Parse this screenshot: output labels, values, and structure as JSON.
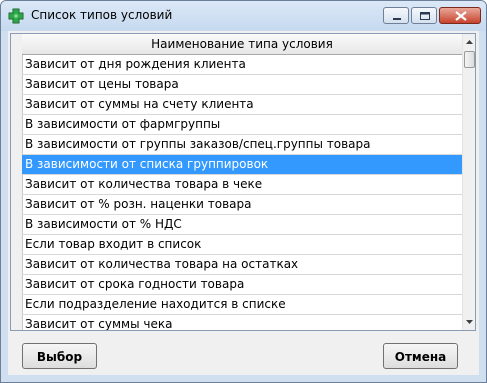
{
  "window": {
    "title": "Список типов условий",
    "icon": "green-cross-icon",
    "accent_color": "#3399ff"
  },
  "table": {
    "column_header": "Наименование типа условия",
    "selected_index": 5,
    "rows": [
      "Зависит от дня рождения клиента",
      "Зависит от цены товара",
      "Зависит от суммы на счету клиента",
      "В зависимости от фармгруппы",
      "В зависимости от группы заказов/спец.группы товара",
      "В зависимости от списка группировок",
      "Зависит от количества товара в чеке",
      "Зависит от % розн. наценки товара",
      "В зависимости от % НДС",
      "Если товар входит в список",
      "Зависит от количества товара на остатках",
      "Зависит от срока годности товара",
      "Если подразделение находится в списке",
      "Зависит от суммы чека"
    ]
  },
  "buttons": {
    "select": "Выбор",
    "cancel": "Отмена"
  }
}
